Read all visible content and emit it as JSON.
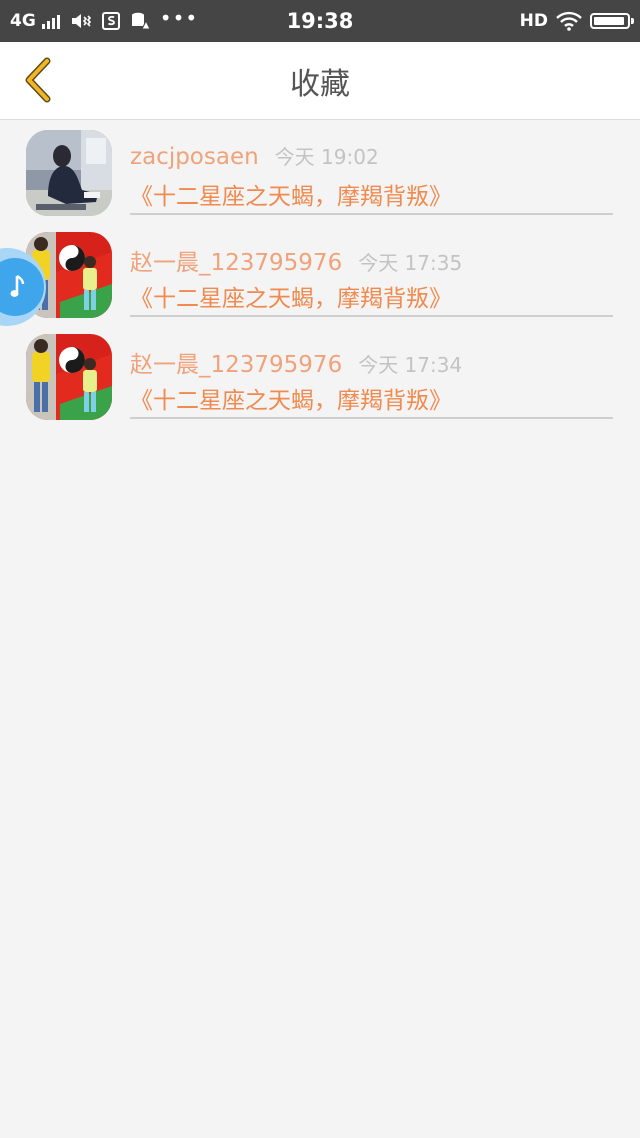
{
  "status_bar": {
    "network": "4G",
    "time": "19:38",
    "hd": "HD",
    "battery_level": 0.95
  },
  "header": {
    "title": "收藏"
  },
  "colors": {
    "accent_user": "#f0a27a",
    "accent_title": "#f08a4e",
    "back_icon": "#e8a21c",
    "music_bubble": "#3fa6ec"
  },
  "favorites": [
    {
      "user": "zacjposaen",
      "time": "今天 19:02",
      "title": "《十二星座之天蝎，摩羯背叛》"
    },
    {
      "user": "赵一晨_123795976",
      "time": "今天 17:35",
      "title": "《十二星座之天蝎，摩羯背叛》"
    },
    {
      "user": "赵一晨_123795976",
      "time": "今天 17:34",
      "title": "《十二星座之天蝎，摩羯背叛》"
    }
  ]
}
